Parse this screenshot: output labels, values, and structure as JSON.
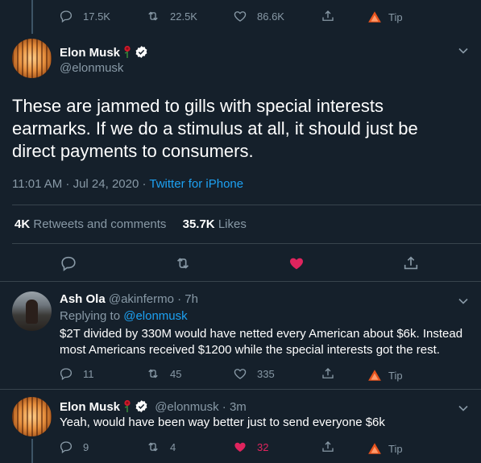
{
  "top_actions": {
    "replies": "17.5K",
    "retweets": "22.5K",
    "likes": "86.6K",
    "tip": "Tip"
  },
  "main_tweet": {
    "name": "Elon Musk",
    "handle": "@elonmusk",
    "text": "These are jammed to gills with special interests earmarks. If we do a stimulus at all, it should just be direct payments to consumers.",
    "time": "11:01 AM · Jul 24, 2020",
    "separator": " · ",
    "source": "Twitter for iPhone",
    "retweets_count": "4K",
    "retweets_label": "Retweets and comments",
    "likes_count": "35.7K",
    "likes_label": "Likes"
  },
  "reply1": {
    "name": "Ash Ola",
    "handle": "@akinfermo",
    "time": "· 7h",
    "replying_prefix": "Replying to",
    "replying_to": "@elonmusk",
    "text_line1": "$2T divided by 330M would have netted every American about $6k. Instead",
    "text_line2": "most Americans received $1200 while the special interests got the rest.",
    "replies": "11",
    "retweets": "45",
    "likes": "335",
    "tip": "Tip"
  },
  "reply2": {
    "name": "Elon Musk",
    "handle": "@elonmusk",
    "time": "· 3m",
    "text": "Yeah, would have been way better just to send everyone $6k",
    "replies": "9",
    "retweets": "4",
    "likes": "32",
    "tip": "Tip"
  },
  "colors": {
    "background": "#15202b",
    "muted": "#8899a6",
    "link": "#1da1f2",
    "like": "#e0245e",
    "divider": "#38444d"
  }
}
